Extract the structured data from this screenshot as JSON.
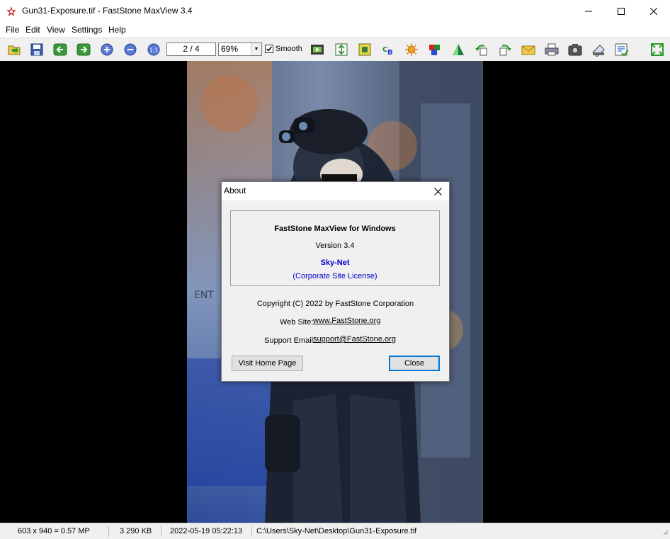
{
  "window": {
    "title": "Gun31-Exposure.tif - FastStone MaxView 3.4"
  },
  "menu": [
    "File",
    "Edit",
    "View",
    "Settings",
    "Help"
  ],
  "toolbar": {
    "page_indicator": "2 / 4",
    "zoom_value": "69%",
    "smooth_label": "Smooth",
    "smooth_checked": true,
    "icons": [
      "open-icon",
      "save-icon",
      "previous-icon",
      "next-icon",
      "zoom-in-icon",
      "zoom-out-icon",
      "actual-size-icon",
      "slideshow-icon",
      "resize-icon",
      "crop-icon",
      "color-balance-icon",
      "adjust-lighting-icon",
      "rgb-icon",
      "sharpen-icon",
      "rotate-left-icon",
      "rotate-right-icon",
      "email-icon",
      "print-icon",
      "capture-icon",
      "scan-icon",
      "settings-icon",
      "fullscreen-icon"
    ]
  },
  "status": {
    "dimensions": "603 x 940 = 0.57 MP",
    "file_size": "3 290 KB",
    "date": "2022-05-19 05:22:13",
    "path": "C:\\Users\\Sky-Net\\Desktop\\Gun31-Exposure.tif"
  },
  "about": {
    "title": "About",
    "product": "FastStone MaxView for Windows",
    "version": "Version 3.4",
    "licensee": "Sky-Net",
    "license_type": "(Corporate Site License)",
    "copyright": "Copyright (C) 2022 by FastStone Corporation",
    "web_label": "Web Site:",
    "web_link": "www.FastStone.org",
    "email_label": "Support Email:",
    "email_link": "support@FastStone.org",
    "visit_button": "Visit Home Page",
    "close_button": "Close"
  },
  "colors": {
    "licensee_blue": "#0000cc",
    "focus_blue": "#0078d7"
  }
}
